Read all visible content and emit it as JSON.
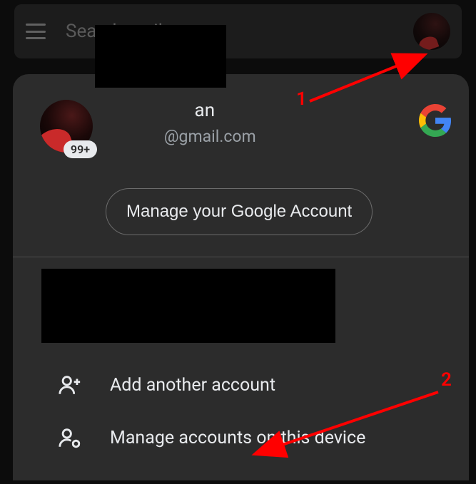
{
  "search": {
    "placeholder": "Search mail"
  },
  "account": {
    "name_visible_suffix": "an",
    "email_suffix": "@gmail.com",
    "badge": "99+"
  },
  "buttons": {
    "manage_account": "Manage your Google Account"
  },
  "actions": {
    "add_account": "Add another account",
    "manage_device": "Manage accounts on this device"
  },
  "annotations": {
    "one": "1",
    "two": "2"
  }
}
